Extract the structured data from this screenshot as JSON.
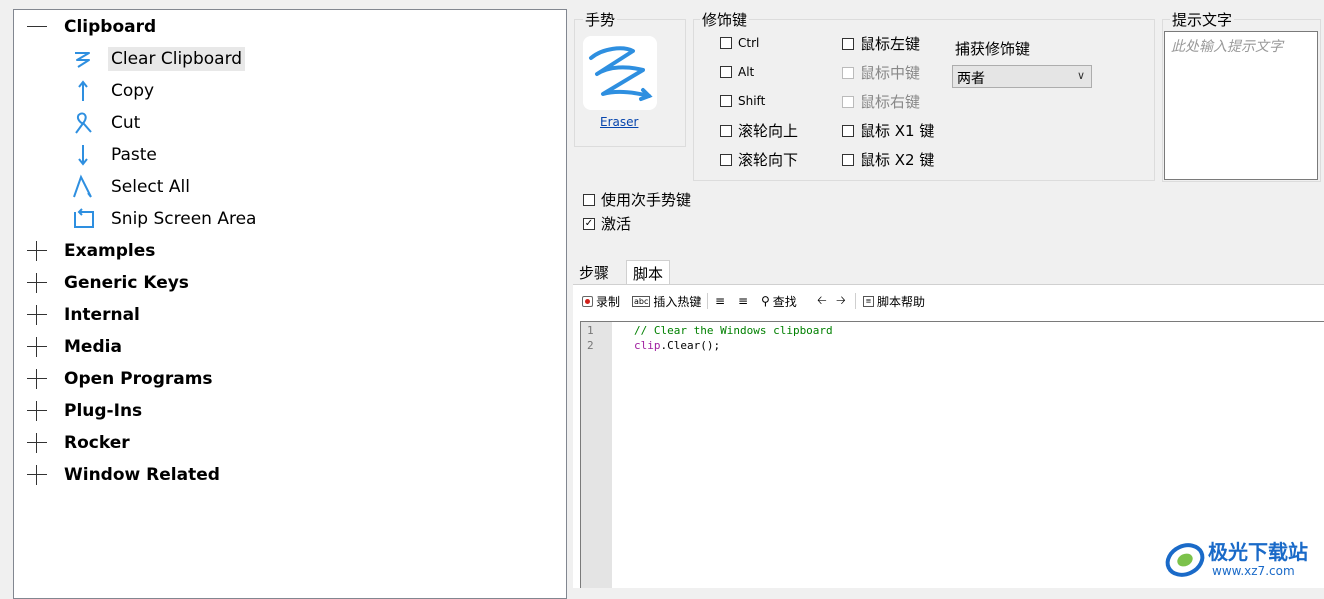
{
  "tree": {
    "categories": [
      {
        "label": "Clipboard",
        "expanded": true,
        "children": [
          {
            "label": "Clear Clipboard",
            "icon": "zigzag-gesture-icon",
            "selected": true
          },
          {
            "label": "Copy",
            "icon": "arrow-up-gesture-icon"
          },
          {
            "label": "Cut",
            "icon": "loop-gesture-icon"
          },
          {
            "label": "Paste",
            "icon": "arrow-down-gesture-icon"
          },
          {
            "label": "Select All",
            "icon": "caret-gesture-icon"
          },
          {
            "label": "Snip Screen Area",
            "icon": "rectangle-gesture-icon"
          }
        ]
      },
      {
        "label": "Examples",
        "expanded": false
      },
      {
        "label": "Generic Keys",
        "expanded": false
      },
      {
        "label": "Internal",
        "expanded": false
      },
      {
        "label": "Media",
        "expanded": false
      },
      {
        "label": "Open Programs",
        "expanded": false
      },
      {
        "label": "Plug-Ins",
        "expanded": false
      },
      {
        "label": "Rocker",
        "expanded": false
      },
      {
        "label": "Window Related",
        "expanded": false
      }
    ]
  },
  "gesture": {
    "title": "手势",
    "name": "Eraser",
    "icon": "zigzag-gesture-icon",
    "stroke_color": "#2e8fe0"
  },
  "modifiers": {
    "title": "修饰键",
    "left_column": [
      {
        "label": "Ctrl",
        "checked": false
      },
      {
        "label": "Alt",
        "checked": false
      },
      {
        "label": "Shift",
        "checked": false
      },
      {
        "label": "滚轮向上",
        "checked": false
      },
      {
        "label": "滚轮向下",
        "checked": false
      }
    ],
    "right_column": [
      {
        "label": "鼠标左键",
        "checked": false,
        "disabled": false
      },
      {
        "label": "鼠标中键",
        "checked": false,
        "disabled": true
      },
      {
        "label": "鼠标右键",
        "checked": false,
        "disabled": true
      },
      {
        "label": "鼠标 X1 键",
        "checked": false,
        "disabled": false
      },
      {
        "label": "鼠标 X2 键",
        "checked": false,
        "disabled": false
      }
    ],
    "capture_label": "捕获修饰键",
    "capture_value": "两者"
  },
  "hint": {
    "title": "提示文字",
    "placeholder": "此处输入提示文字"
  },
  "options": {
    "secondary_button": {
      "label": "使用次手势键",
      "checked": false
    },
    "activate": {
      "label": "激活",
      "checked": true
    }
  },
  "tabs": [
    {
      "label": "步骤",
      "active": false
    },
    {
      "label": "脚本",
      "active": true
    }
  ],
  "toolbar": {
    "record": "录制",
    "insert_hotkey": "插入热键",
    "find": "查找",
    "script_help": "脚本帮助"
  },
  "editor": {
    "lines": [
      {
        "no": "1",
        "text": "// Clear the Windows clipboard"
      },
      {
        "no": "2",
        "obj": "clip",
        "rest": ".Clear();"
      }
    ]
  },
  "watermark": {
    "title": "极光下载站",
    "url": "www.xz7.com"
  },
  "colors": {
    "accent": "#2e8fe0",
    "link": "#0645ad",
    "comment": "#008000",
    "keyword": "#a020a0"
  }
}
